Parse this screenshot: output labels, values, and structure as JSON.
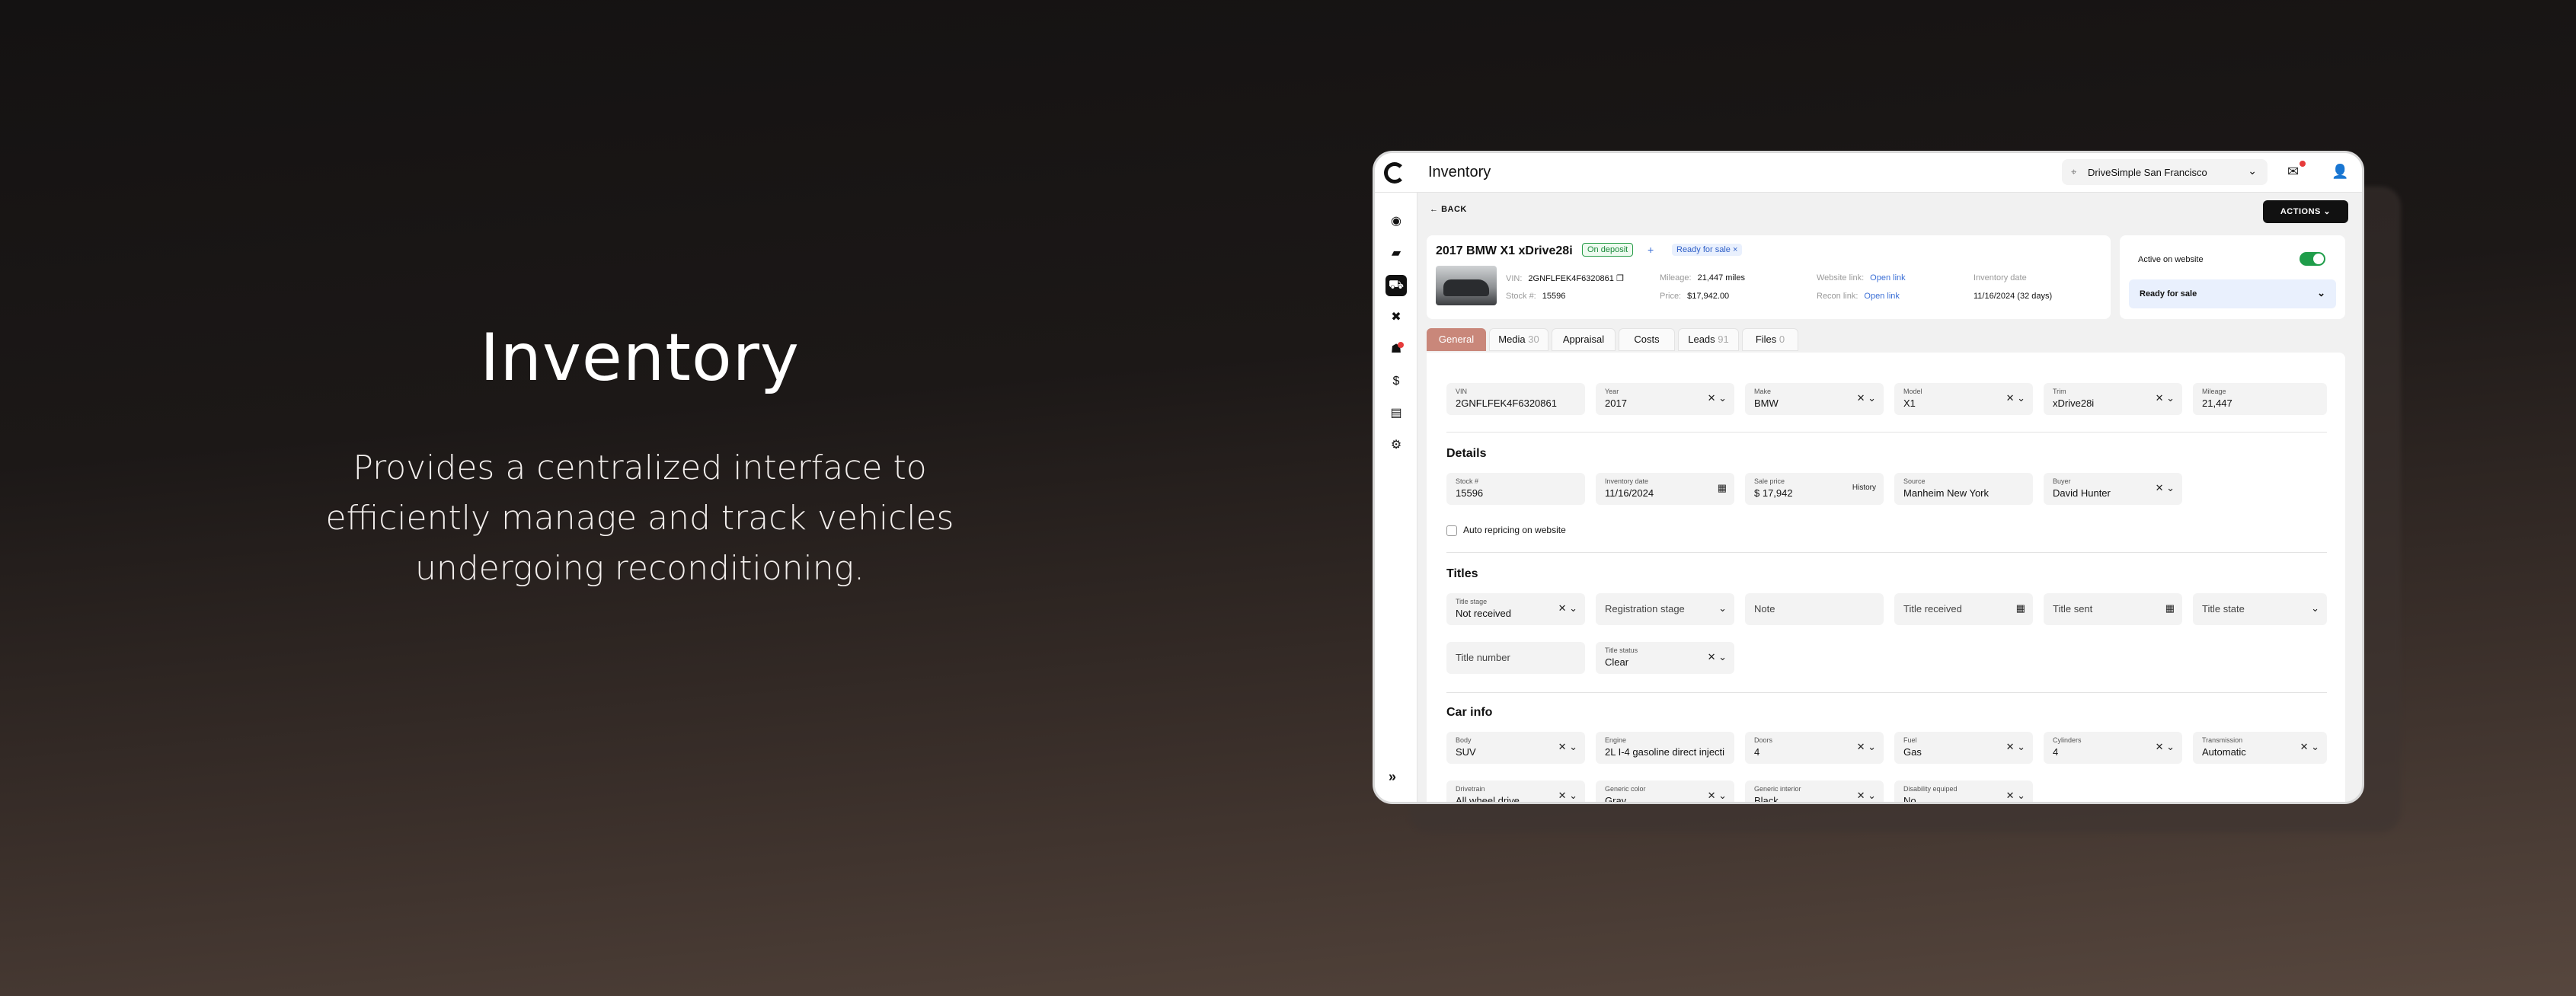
{
  "hero": {
    "title": "Inventory",
    "description": "Provides a centralized interface to efficiently manage and track vehicles undergoing reconditioning."
  },
  "app": {
    "title": "Inventory",
    "location": "DriveSimple San Francisco",
    "back_label": "BACK",
    "actions_label": "ACTIONS"
  },
  "vehicle": {
    "title": "2017 BMW X1 xDrive28i",
    "deposit_badge": "On deposit",
    "plus": "+",
    "ready_badge": "Ready for sale ×",
    "vin_label": "VIN:",
    "vin": "2GNFLFEK4F6320861",
    "stock_label": "Stock #:",
    "stock": "15596",
    "mileage_label": "Mileage:",
    "mileage": "21,447 miles",
    "price_label": "Price:",
    "price": "$17,942.00",
    "website_label": "Website link:",
    "website_link": "Open link",
    "recon_label": "Recon link:",
    "recon_link": "Open link",
    "inventory_date_label": "Inventory date",
    "inventory_date": "11/16/2024 (32 days)"
  },
  "status": {
    "active_label": "Active on website",
    "active": true,
    "select_value": "Ready for sale"
  },
  "tabs": [
    {
      "label": "General",
      "count": ""
    },
    {
      "label": "Media",
      "count": "30"
    },
    {
      "label": "Appraisal",
      "count": ""
    },
    {
      "label": "Costs",
      "count": ""
    },
    {
      "label": "Leads",
      "count": "91"
    },
    {
      "label": "Files",
      "count": "0"
    }
  ],
  "general": {
    "fields": [
      {
        "label": "VIN",
        "value": "2GNFLFEK4F6320861"
      },
      {
        "label": "Year",
        "value": "2017"
      },
      {
        "label": "Make",
        "value": "BMW"
      },
      {
        "label": "Model",
        "value": "X1"
      },
      {
        "label": "Trim",
        "value": "xDrive28i"
      },
      {
        "label": "Mileage",
        "value": "21,447"
      }
    ]
  },
  "details": {
    "heading": "Details",
    "fields": [
      {
        "label": "Stock #",
        "value": "15596"
      },
      {
        "label": "Inventory date",
        "value": "11/16/2024"
      },
      {
        "label": "Sale price",
        "value": "$ 17,942"
      },
      {
        "label": "Source",
        "value": "Manheim New York"
      },
      {
        "label": "Buyer",
        "value": "David Hunter"
      }
    ],
    "history_label": "History",
    "auto_repricing": "Auto repricing on website"
  },
  "titles": {
    "heading": "Titles",
    "title_stage_label": "Title stage",
    "title_stage": "Not received",
    "registration_stage": "Registration stage",
    "note": "Note",
    "title_received": "Title received",
    "title_sent": "Title sent",
    "title_state": "Title state",
    "title_number": "Title number",
    "title_status_label": "Title status",
    "title_status": "Clear"
  },
  "car_info": {
    "heading": "Car info",
    "fields": [
      {
        "label": "Body",
        "value": "SUV"
      },
      {
        "label": "Engine",
        "value": "2L I-4 gasoline direct injecti"
      },
      {
        "label": "Doors",
        "value": "4"
      },
      {
        "label": "Fuel",
        "value": "Gas"
      },
      {
        "label": "Cylinders",
        "value": "4"
      },
      {
        "label": "Transmission",
        "value": "Automatic"
      }
    ],
    "row2": [
      {
        "label": "Drivetrain",
        "value": "All wheel drive"
      },
      {
        "label": "Generic color",
        "value": "Gray"
      },
      {
        "label": "Generic interior",
        "value": "Black"
      },
      {
        "label": "Disability equiped",
        "value": "No"
      }
    ]
  },
  "colors": {
    "accent": "#c9877a",
    "success": "#1f9d4a",
    "link": "#3b6fd6"
  }
}
